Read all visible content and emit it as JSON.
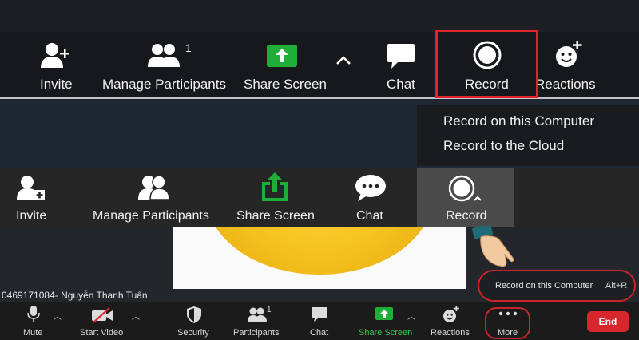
{
  "panel1": {
    "invite": "Invite",
    "manage_participants": "Manage Participants",
    "participant_count": "1",
    "share_screen": "Share Screen",
    "chat": "Chat",
    "record": "Record",
    "reactions": "Reactions"
  },
  "record_menu": {
    "on_computer": "Record on this Computer",
    "to_cloud": "Record to the Cloud"
  },
  "panel2": {
    "invite": "Invite",
    "manage_participants": "Manage Participants",
    "share_screen": "Share Screen",
    "chat": "Chat",
    "record": "Record"
  },
  "meeting": {
    "participant_name": "0469171084- Nguyễn Thanh Tuấn"
  },
  "tooltip": {
    "text": "Record on this Computer",
    "shortcut": "Alt+R"
  },
  "bottombar": {
    "mute": "Mute",
    "start_video": "Start Video",
    "security": "Security",
    "participants": "Participants",
    "participant_count": "1",
    "chat": "Chat",
    "share_screen": "Share Screen",
    "reactions": "Reactions",
    "more": "More",
    "end": "End"
  },
  "colors": {
    "share_green": "#1fae38",
    "highlight_red": "#e0242b",
    "end_red": "#d7262c"
  }
}
